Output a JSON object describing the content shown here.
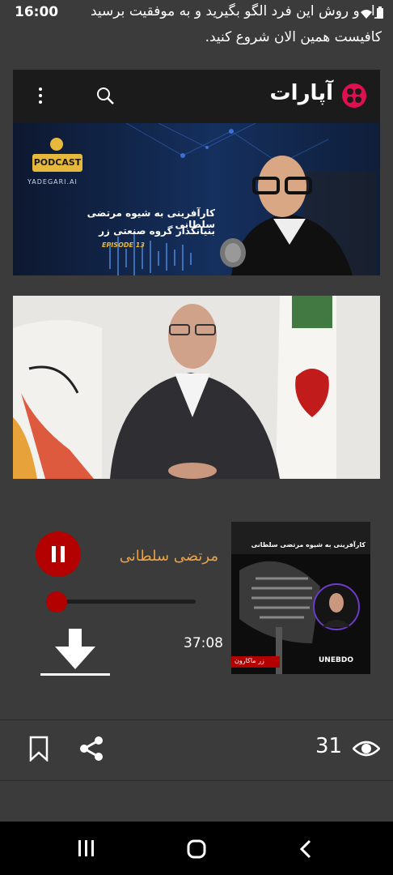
{
  "status": {
    "time": "16:00"
  },
  "intro": {
    "line1": "راه و روش این فرد الگو بگیرید و به موفقیت برسید",
    "line2": "کافیست همین الان شروع کنید."
  },
  "aparat": {
    "logo_text": "آپارات",
    "video": {
      "badge": "PODCAST",
      "brand": "YADEGARI.AI",
      "title_line1": "کارآفرینی به شیوه  مرتضی سلطانی",
      "title_line2": "بنیانگذار گروه صنعتی زر",
      "episode": "EPISODE 13"
    }
  },
  "player": {
    "artist": "مرتضی سلطانی",
    "duration": "37:08",
    "progress": 0.0,
    "cover": {
      "title": "کارآفرینی به شیوه مرتضی سلطانی",
      "brand_bottom": "UNEBDO",
      "brand_left": "زر ماکارون"
    }
  },
  "actions": {
    "views": "31"
  },
  "colors": {
    "background": "#3b3b3b",
    "accent_red": "#b30000",
    "artist_orange": "#e8a24a",
    "podcast_yellow": "#e6b93c"
  },
  "icons": [
    "wifi-icon",
    "battery-icon",
    "search-icon",
    "more-vert-icon",
    "pause-icon",
    "download-icon",
    "bookmark-icon",
    "share-icon",
    "eye-icon",
    "recents-icon",
    "home-icon",
    "back-icon"
  ]
}
